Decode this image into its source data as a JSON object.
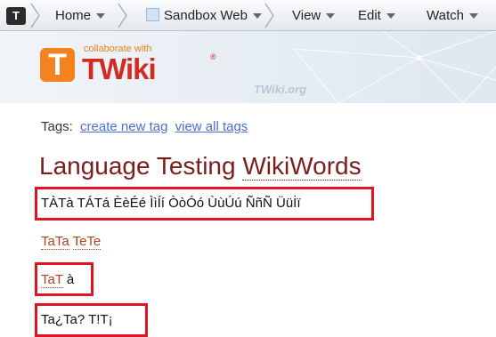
{
  "toolbar": {
    "logo_glyph": "T",
    "items": [
      {
        "label": "Home"
      },
      {
        "label": "Sandbox Web"
      },
      {
        "label": "View"
      },
      {
        "label": "Edit"
      },
      {
        "label": "Watch"
      }
    ]
  },
  "header": {
    "logo_t": "T",
    "collab_text": "collaborate with",
    "logo_word": "TWiki",
    "registered": "®",
    "site": "TWiki.org"
  },
  "tags": {
    "label": "Tags:",
    "create_link": "create new tag",
    "view_link": "view all tags"
  },
  "title": {
    "prefix": "Language Testing",
    "wikiword": "WikiWords"
  },
  "lines": {
    "accents": "TÀTà TÁTá ÈèÉé ÌìÍí ÒòÓó ÙùÚú ÑñÑ Üüİï",
    "tata_1": "TaTa",
    "tete": "TeTe",
    "tat": "TaT",
    "a_grave": "à",
    "punct": "Ta¿Ta? T!T¡"
  },
  "colors": {
    "highlight": "#e01424",
    "wikiword": "#a8441f",
    "title": "#7a1d1d",
    "link": "#4a6fd0",
    "logo_orange": "#f58220",
    "logo_red": "#d22b24"
  }
}
